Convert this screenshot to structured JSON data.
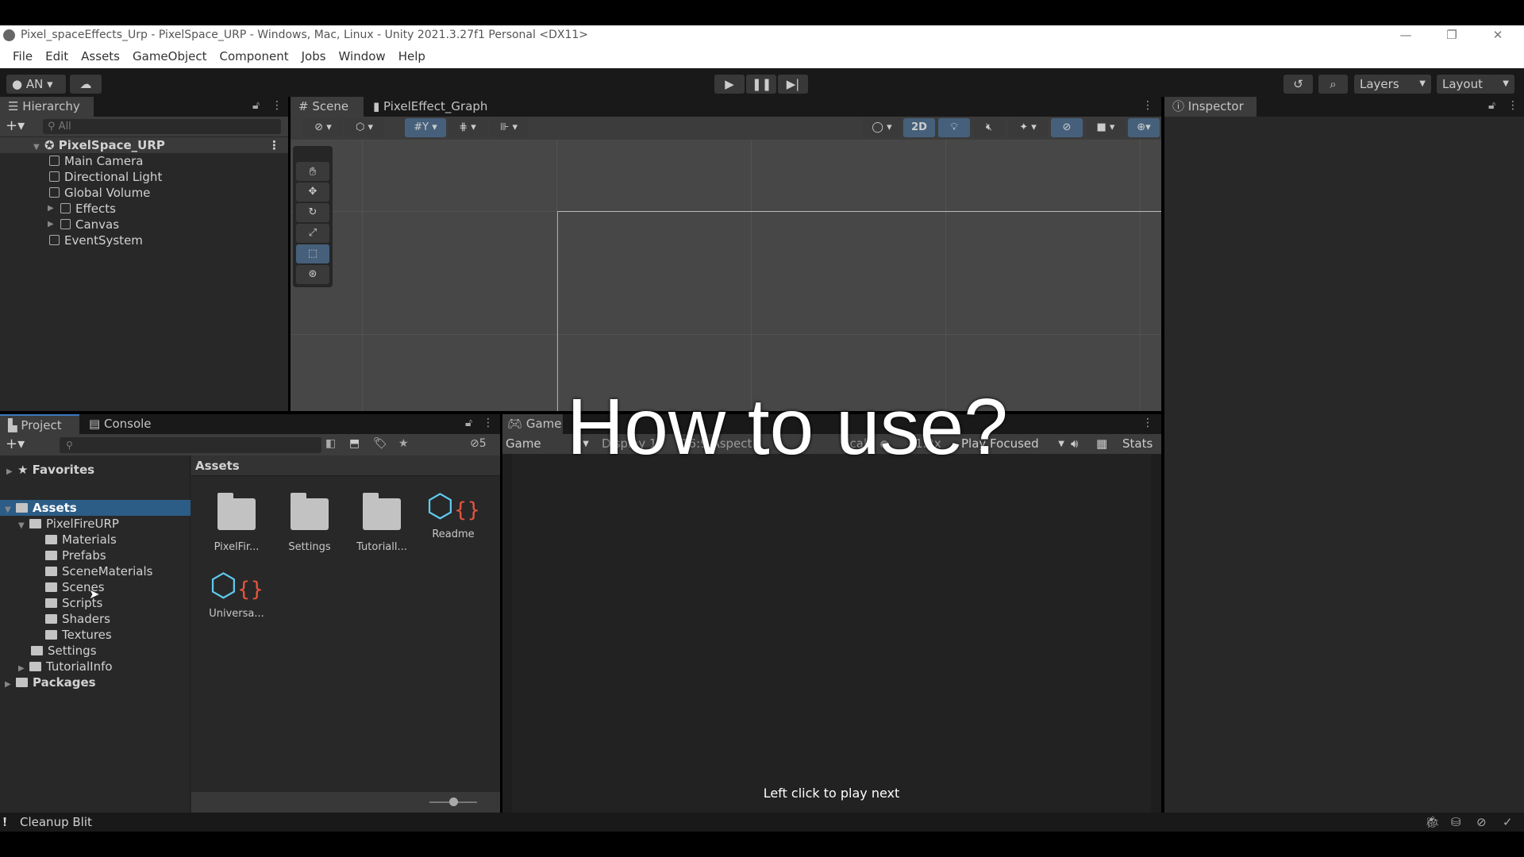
{
  "window": {
    "title": "Pixel_spaceEffects_Urp - PixelSpace_URP - Windows, Mac, Linux - Unity 2021.3.27f1 Personal <DX11>"
  },
  "menu": [
    "File",
    "Edit",
    "Assets",
    "GameObject",
    "Component",
    "Jobs",
    "Window",
    "Help"
  ],
  "toolbar": {
    "account": "AN ▾",
    "layers": "Layers",
    "layout": "Layout"
  },
  "hierarchy": {
    "tab": "Hierarchy",
    "search_placeholder": "All",
    "scene": "PixelSpace_URP",
    "items": [
      {
        "label": "Main Camera",
        "expandable": false
      },
      {
        "label": "Directional Light",
        "expandable": false
      },
      {
        "label": "Global Volume",
        "expandable": false
      },
      {
        "label": "Effects",
        "expandable": true
      },
      {
        "label": "Canvas",
        "expandable": true
      },
      {
        "label": "EventSystem",
        "expandable": false
      }
    ]
  },
  "scene": {
    "tabs": [
      "Scene",
      "PixelEffect_Graph"
    ],
    "mode_2d": "2D"
  },
  "inspector": {
    "tab": "Inspector"
  },
  "project": {
    "tabs": [
      "Project",
      "Console"
    ],
    "hidden_count": "5",
    "favorites": "Favorites",
    "breadcrumb": "Assets",
    "tree": [
      {
        "label": "Assets",
        "depth": 0,
        "selected": true
      },
      {
        "label": "PixelFireURP",
        "depth": 1
      },
      {
        "label": "Materials",
        "depth": 2
      },
      {
        "label": "Prefabs",
        "depth": 2
      },
      {
        "label": "SceneMaterials",
        "depth": 2
      },
      {
        "label": "Scenes",
        "depth": 2
      },
      {
        "label": "Scripts",
        "depth": 2
      },
      {
        "label": "Shaders",
        "depth": 2
      },
      {
        "label": "Textures",
        "depth": 2
      },
      {
        "label": "Settings",
        "depth": 1
      },
      {
        "label": "TutorialInfo",
        "depth": 1
      },
      {
        "label": "Packages",
        "depth": 0
      }
    ],
    "assets": [
      {
        "label": "PixelFir...",
        "type": "folder"
      },
      {
        "label": "Settings",
        "type": "folder"
      },
      {
        "label": "Tutoriall...",
        "type": "folder"
      },
      {
        "label": "Readme",
        "type": "script-asset"
      },
      {
        "label": "Universa...",
        "type": "script-asset"
      }
    ]
  },
  "game": {
    "tab": "Game",
    "view": "Game",
    "display": "Display 1",
    "aspect": "16:9 Aspect",
    "scale_label": "Scale",
    "scale": "1.2x",
    "play_mode": "Play Focused",
    "stats": "Stats",
    "hint": "Left click to play next"
  },
  "overlay": {
    "caption": "How to use?"
  },
  "status": {
    "message": "Cleanup Blit"
  },
  "colors": {
    "selection": "#2c5d87",
    "active_tool": "#46607c",
    "panel": "#282828"
  }
}
